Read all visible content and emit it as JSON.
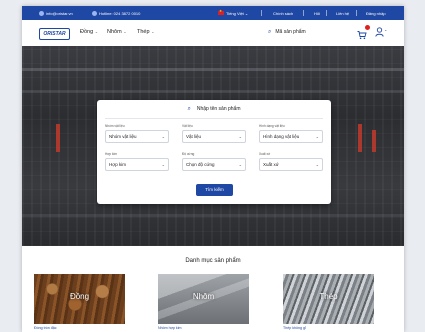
{
  "topbar": {
    "email": "info@oristar.vn",
    "hotline": "Hotline: 024 3872 0010",
    "language": "Tiếng Việt",
    "links": [
      "Chính sách",
      "Hỏi",
      "Liên hệ",
      "Đăng nhập"
    ]
  },
  "header": {
    "logo": "ORISTAR",
    "nav": [
      "Đồng",
      "Nhôm",
      "Thép"
    ],
    "search_label": "Mã sản phẩm"
  },
  "search_panel": {
    "title": "Nhập tên sản phẩm",
    "fields": [
      {
        "label": "Nhóm vật liệu",
        "value": "Nhóm vật liệu"
      },
      {
        "label": "Vật liệu",
        "value": "Vật liệu"
      },
      {
        "label": "Hình dạng vật liệu",
        "value": "Hình dạng vật liệu"
      },
      {
        "label": "Hợp kim",
        "value": "Hợp kim"
      },
      {
        "label": "Độ cứng",
        "value": "Chọn độ cứng"
      },
      {
        "label": "Xuất xứ",
        "value": "Xuất xứ"
      }
    ],
    "button": "Tìm kiếm"
  },
  "categories": {
    "title": "Danh mục sản phẩm",
    "items": [
      {
        "label": "Đồng",
        "name": "Đồng tròn đặc"
      },
      {
        "label": "Nhôm",
        "name": "Nhôm hợp kim"
      },
      {
        "label": "Thép",
        "name": "Thép không gỉ"
      }
    ]
  },
  "colors": {
    "primary": "#1f47a4",
    "accent_red": "#e02020"
  }
}
